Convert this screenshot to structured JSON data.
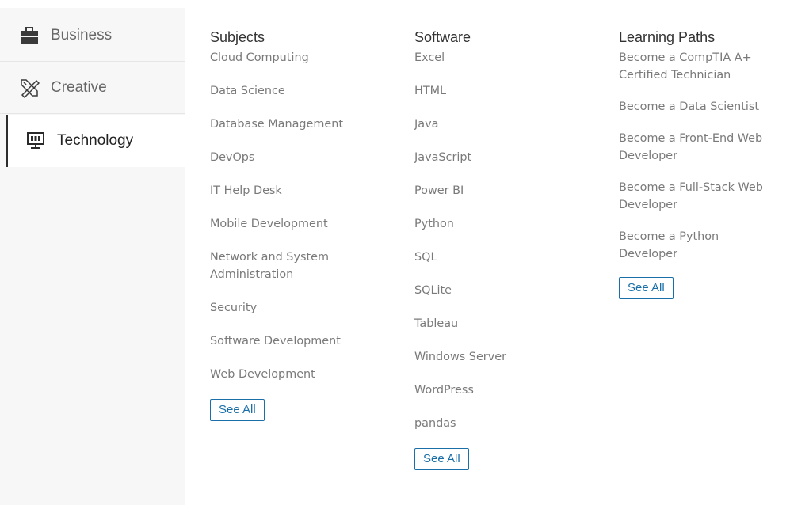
{
  "sidebar": {
    "items": [
      {
        "label": "Business",
        "icon": "briefcase-icon",
        "active": false
      },
      {
        "label": "Creative",
        "icon": "design-tools-icon",
        "active": false
      },
      {
        "label": "Technology",
        "icon": "monitor-icon",
        "active": true
      }
    ]
  },
  "columns": {
    "subjects": {
      "title": "Subjects",
      "items": [
        "Cloud Computing",
        "Data Science",
        "Database Management",
        "DevOps",
        "IT Help Desk",
        "Mobile Development",
        "Network and System Administration",
        "Security",
        "Software Development",
        "Web Development"
      ],
      "see_all": "See All"
    },
    "software": {
      "title": "Software",
      "items": [
        "Excel",
        "HTML",
        "Java",
        "JavaScript",
        "Power BI",
        "Python",
        "SQL",
        "SQLite",
        "Tableau",
        "Windows Server",
        "WordPress",
        "pandas"
      ],
      "see_all": "See All"
    },
    "learning_paths": {
      "title": "Learning Paths",
      "items": [
        "Become a CompTIA A+ Certified Technician",
        "Become a Data Scientist",
        "Become a Front-End Web Developer",
        "Become a Full-Stack Web Developer",
        "Become a Python Developer"
      ],
      "see_all": "See All"
    }
  },
  "colors": {
    "accent": "#1a6fa8",
    "sidebar_bg": "#f7f7f7",
    "text_muted": "#7a7a7a"
  }
}
